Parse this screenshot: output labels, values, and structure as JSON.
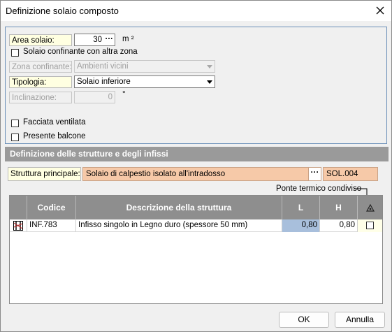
{
  "window": {
    "title": "Definizione solaio composto"
  },
  "form": {
    "area_label": "Area solaio:",
    "area_value": "30",
    "area_dots": "···",
    "area_unit": "m ²",
    "zone_checkbox_label": "Solaio confinante con altra zona",
    "zona_label": "Zona confinante:",
    "zona_value": "Ambienti vicini",
    "tipologia_label": "Tipologia:",
    "tipologia_value": "Solaio inferiore",
    "inclinazione_label": "Inclinazione:",
    "inclinazione_value": "0",
    "inclinazione_unit": "°",
    "facciata_label": "Facciata ventilata",
    "balcone_label": "Presente balcone"
  },
  "structures": {
    "header": "Definizione delle strutture e degli infissi",
    "principale_label": "Struttura principale:",
    "principale_value": "Solaio di calpestio isolato all'intradosso",
    "principale_dots": "···",
    "principale_code": "SOL.004",
    "ponte_label": "Ponte termico condiviso"
  },
  "grid": {
    "columns": {
      "codice": "Codice",
      "descrizione": "Descrizione della struttura",
      "l": "L",
      "h": "H"
    },
    "rows": [
      {
        "codice": "INF.783",
        "descrizione": "Infisso singolo in Legno duro (spessore 50 mm)",
        "l": "0,80",
        "h": "0,80"
      }
    ]
  },
  "buttons": {
    "ok": "OK",
    "cancel": "Annulla"
  },
  "colors": {
    "accent_panel_border": "#6b8fb8",
    "label_yellow": "#ffffe1",
    "structure_field": "#f6c9a8",
    "selected_cell": "#a8bfdc",
    "grid_header": "#8e8e8e"
  },
  "icons": {
    "close": "close-icon",
    "row_type": "window-frame-icon",
    "ponte_header": "thermal-bridge-icon"
  }
}
